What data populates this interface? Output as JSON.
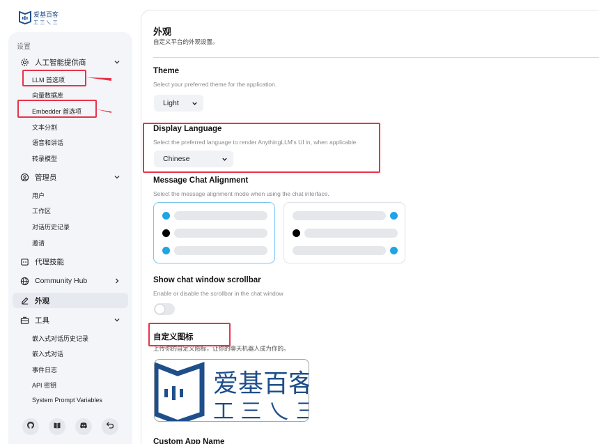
{
  "brand": {
    "logo_top": "爱基百客",
    "logo_bottom": "工 三 乀 三"
  },
  "sidebar": {
    "section_title": "设置",
    "groups": [
      {
        "label": "人工智能提供商",
        "icon": "gear-icon"
      },
      {
        "label": "管理员",
        "icon": "admin-icon"
      },
      {
        "label": "代理技能",
        "icon": "agent-icon"
      },
      {
        "label": "Community Hub",
        "icon": "globe-icon"
      },
      {
        "label": "外观",
        "icon": "pen-icon"
      },
      {
        "label": "工具",
        "icon": "briefcase-icon"
      }
    ],
    "ai_items": [
      "LLM 首选项",
      "向量数据库",
      "Embedder 首选项",
      "文本分割",
      "语音和讲话",
      "转录模型"
    ],
    "admin_items": [
      "用户",
      "工作区",
      "对话历史记录",
      "邀请"
    ],
    "tool_items": [
      "嵌入式对话历史记录",
      "嵌入式对话",
      "事件日志",
      "API 密钥",
      "System Prompt Variables"
    ],
    "bottom_icons": [
      "github-icon",
      "book-icon",
      "discord-icon",
      "undo-icon"
    ]
  },
  "main": {
    "title": "外观",
    "subtitle": "自定义平台的外观设置。",
    "theme": {
      "title": "Theme",
      "desc": "Select your preferred theme for the application.",
      "value": "Light"
    },
    "language": {
      "title": "Display Language",
      "desc": "Select the preferred language to render AnythingLLM's UI in, when applicable.",
      "value": "Chinese"
    },
    "alignment": {
      "title": "Message Chat Alignment",
      "desc": "Select the message alignment mode when using the chat interface."
    },
    "scrollbar": {
      "title": "Show chat window scrollbar",
      "desc": "Enable or disable the scrollbar in the chat window",
      "enabled": false
    },
    "custom_icon": {
      "title": "自定义图标",
      "desc": "上传你的自定义图标，让你的聊天机器人成为你的。"
    },
    "app_name": {
      "title": "Custom App Name"
    }
  },
  "colors": {
    "accent": "#20a4e4",
    "annotation": "#e8334a",
    "brand_blue": "#1e4f8a"
  }
}
